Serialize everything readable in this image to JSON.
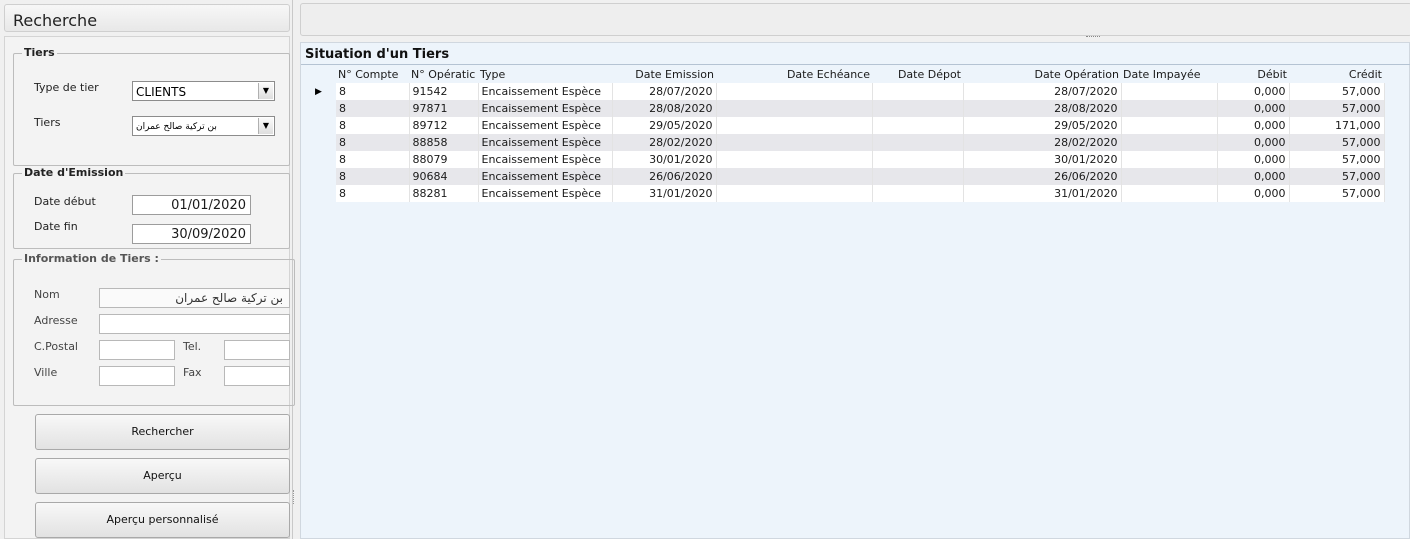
{
  "left": {
    "title": "Recherche",
    "tiers_group": {
      "title": "Tiers",
      "type_label": "Type de tier",
      "type_value": "CLIENTS",
      "tiers_label": "Tiers",
      "tiers_value": "بن تركية صالح عمران"
    },
    "date_group": {
      "title": "Date d'Emission",
      "debut_label": "Date début",
      "debut_value": "01/01/2020",
      "fin_label": "Date fin",
      "fin_value": "30/09/2020"
    },
    "info_group": {
      "title": "Information de Tiers :",
      "nom_label": "Nom",
      "nom_value": "بن تركية صالح عمران",
      "adresse_label": "Adresse",
      "adresse_value": "",
      "cpostal_label": "C.Postal",
      "cpostal_value": "",
      "tel_label": "Tel.",
      "tel_value": "",
      "ville_label": "Ville",
      "ville_value": "",
      "fax_label": "Fax",
      "fax_value": ""
    },
    "buttons": {
      "rechercher": "Rechercher",
      "apercu": "Aperçu",
      "apercu_perso": "Aperçu personnalisé"
    }
  },
  "grid": {
    "title": "Situation d'un Tiers",
    "columns": [
      "N° Compte",
      "N° Opératic",
      "Type",
      "Date Emission",
      "Date Echéance",
      "Date Dépot",
      "Date Opération",
      "Date Impayée",
      "Débit",
      "Crédit"
    ],
    "rows": [
      [
        "8",
        "91542",
        "Encaissement Espèce",
        "28/07/2020",
        "",
        "",
        "28/07/2020",
        "",
        "0,000",
        "57,000"
      ],
      [
        "8",
        "97871",
        "Encaissement Espèce",
        "28/08/2020",
        "",
        "",
        "28/08/2020",
        "",
        "0,000",
        "57,000"
      ],
      [
        "8",
        "89712",
        "Encaissement Espèce",
        "29/05/2020",
        "",
        "",
        "29/05/2020",
        "",
        "0,000",
        "171,000"
      ],
      [
        "8",
        "88858",
        "Encaissement Espèce",
        "28/02/2020",
        "",
        "",
        "28/02/2020",
        "",
        "0,000",
        "57,000"
      ],
      [
        "8",
        "88079",
        "Encaissement Espèce",
        "30/01/2020",
        "",
        "",
        "30/01/2020",
        "",
        "0,000",
        "57,000"
      ],
      [
        "8",
        "90684",
        "Encaissement Espèce",
        "26/06/2020",
        "",
        "",
        "26/06/2020",
        "",
        "0,000",
        "57,000"
      ],
      [
        "8",
        "88281",
        "Encaissement Espèce",
        "31/01/2020",
        "",
        "",
        "31/01/2020",
        "",
        "0,000",
        "57,000"
      ]
    ],
    "current_row_indicator": "▶"
  }
}
